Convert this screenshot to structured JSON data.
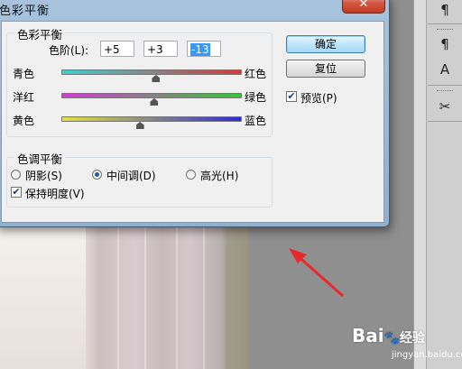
{
  "dialog": {
    "title": "色彩平衡",
    "close_glyph": "✕",
    "balance_group": {
      "title": "色彩平衡",
      "levels_label": "色阶(L):",
      "levels": [
        "+5",
        "+3",
        "-13"
      ],
      "sliders": [
        {
          "left": "青色",
          "right": "红色",
          "value": 5,
          "gradient": [
            "#3ecfd4",
            "#d33a3a"
          ]
        },
        {
          "left": "洋红",
          "right": "绿色",
          "value": 3,
          "gradient": [
            "#d63ad6",
            "#35c735"
          ]
        },
        {
          "left": "黄色",
          "right": "蓝色",
          "value": -13,
          "gradient": [
            "#e2e23a",
            "#2b2bd4"
          ]
        }
      ]
    },
    "tone_group": {
      "title": "色调平衡",
      "shadows": "阴影(S)",
      "midtones": "中间调(D)",
      "highlights": "高光(H)",
      "selected": "midtones",
      "preserve_label": "保持明度(V)",
      "preserve_checked": true
    },
    "ok_label": "确定",
    "reset_label": "复位",
    "preview_label": "预览(P)",
    "preview_checked": true
  },
  "tools": {
    "icons": [
      "paragraph-icon",
      "paragraph-style-icon",
      "character-style-icon",
      "scissors-icon"
    ],
    "glyphs": [
      "¶",
      "¶",
      "A",
      "✂"
    ]
  },
  "watermark": {
    "brand": "Bai",
    "brand_suffix": "经验",
    "url": "jingyan.baidu.com"
  },
  "colors": {
    "annotation_arrow": "#e8282c",
    "dialog_frame": "#9bb9d8"
  }
}
